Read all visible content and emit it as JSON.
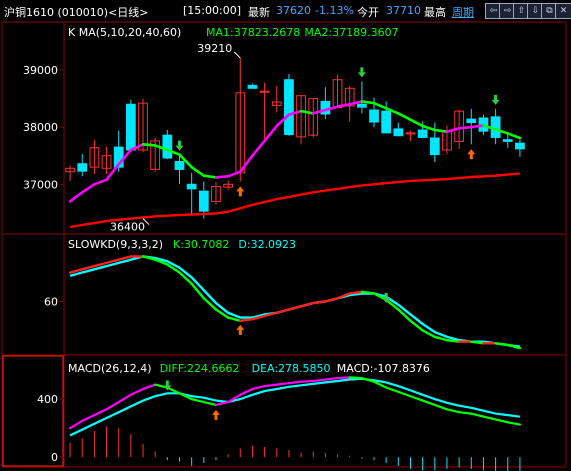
{
  "header": {
    "title": "沪铜1610 (010010)<日线>",
    "time": "[15:00:00]",
    "latest_label": "最新",
    "latest_value": "37620",
    "change_pct": "-1.13%",
    "open_label": "今开",
    "open_value": "37710",
    "high_label": "最高",
    "period_link": "周期",
    "buttons": [
      "⇦",
      "⇨",
      "⇧",
      "⇩",
      "⧉",
      "✕"
    ]
  },
  "colors": {
    "bg": "#000000",
    "grid": "#8b0000",
    "up": "#ff3030",
    "down": "#00e5ff",
    "ma1_up": "#ff00ff",
    "ma1_down": "#00ff00",
    "ma2": "#ff0000",
    "k_line": "#00ffff",
    "d_line": "#ff00ff",
    "axis_text": "#ffffff"
  },
  "chart_data": [
    {
      "type": "candlestick",
      "title": "K  MA(5,10,20,40,60)",
      "legend": [
        {
          "label": "MA1:37823.2678",
          "color": "#00ff00"
        },
        {
          "label": "MA2:37189.3607",
          "color": "#00ff00"
        }
      ],
      "yticks": [
        37000,
        38000,
        39000
      ],
      "ylim": [
        36200,
        39350
      ],
      "annotations": [
        {
          "text": "39210",
          "bar": 14,
          "value": 39210
        },
        {
          "text": "36400",
          "bar": 6,
          "value": 36400
        }
      ],
      "signals": [
        {
          "bar": 9,
          "kind": "sell"
        },
        {
          "bar": 14,
          "kind": "buy"
        },
        {
          "bar": 24,
          "kind": "sell"
        },
        {
          "bar": 33,
          "kind": "buy"
        },
        {
          "bar": 35,
          "kind": "sell"
        }
      ],
      "ohlc": [
        [
          37220,
          37330,
          37060,
          37280
        ],
        [
          37360,
          37530,
          37140,
          37230
        ],
        [
          37300,
          37780,
          37180,
          37640
        ],
        [
          37280,
          37660,
          37180,
          37500
        ],
        [
          37650,
          37940,
          37220,
          37300
        ],
        [
          38400,
          38480,
          37660,
          37600
        ],
        [
          37600,
          38500,
          37560,
          38420
        ],
        [
          37260,
          37820,
          37220,
          37760
        ],
        [
          37860,
          37950,
          37440,
          37460
        ],
        [
          37400,
          37520,
          37000,
          37260
        ],
        [
          37000,
          37200,
          36450,
          36920
        ],
        [
          36880,
          37050,
          36400,
          36530
        ],
        [
          36700,
          37040,
          36640,
          36960
        ],
        [
          36950,
          37070,
          36900,
          37000
        ],
        [
          37200,
          39210,
          37050,
          38600
        ],
        [
          38730,
          38760,
          38680,
          38680
        ],
        [
          38610,
          38780,
          37800,
          38630
        ],
        [
          38380,
          38720,
          38260,
          38440
        ],
        [
          38830,
          38930,
          37850,
          37870
        ],
        [
          37830,
          38550,
          37700,
          38550
        ],
        [
          37860,
          38500,
          37820,
          38500
        ],
        [
          38450,
          38700,
          38140,
          38230
        ],
        [
          38340,
          38920,
          38330,
          38830
        ],
        [
          38370,
          38720,
          38100,
          38680
        ],
        [
          38400,
          38800,
          38240,
          38350
        ],
        [
          38300,
          38520,
          38000,
          38090
        ],
        [
          38280,
          38450,
          37890,
          37900
        ],
        [
          37970,
          38080,
          37840,
          37850
        ],
        [
          37880,
          37940,
          37760,
          37900
        ],
        [
          37950,
          38100,
          37830,
          37820
        ],
        [
          37810,
          38080,
          37390,
          37520
        ],
        [
          37600,
          38030,
          37530,
          37940
        ],
        [
          37750,
          38300,
          37620,
          38280
        ],
        [
          38140,
          38320,
          37700,
          38080
        ],
        [
          38160,
          38220,
          37860,
          37930
        ],
        [
          38180,
          38320,
          37700,
          37820
        ],
        [
          37780,
          37920,
          37640,
          37750
        ],
        [
          37720,
          37780,
          37480,
          37620
        ]
      ],
      "series": [
        {
          "name": "MA1",
          "values": [
            36700,
            36860,
            37000,
            37080,
            37350,
            37600,
            37700,
            37680,
            37600,
            37520,
            37300,
            37150,
            37120,
            37140,
            37220,
            37500,
            37760,
            38020,
            38220,
            38280,
            38240,
            38300,
            38360,
            38400,
            38450,
            38420,
            38330,
            38240,
            38130,
            38020,
            37950,
            37920,
            37980,
            38000,
            38030,
            37960,
            37890,
            37810
          ]
        },
        {
          "name": "MA2",
          "values": [
            36250,
            36290,
            36320,
            36360,
            36380,
            36400,
            36420,
            36440,
            36450,
            36460,
            36470,
            36480,
            36490,
            36520,
            36580,
            36640,
            36690,
            36740,
            36780,
            36820,
            36860,
            36890,
            36920,
            36950,
            36980,
            37000,
            37020,
            37040,
            37060,
            37070,
            37080,
            37090,
            37110,
            37130,
            37140,
            37150,
            37170,
            37190
          ]
        }
      ]
    },
    {
      "type": "line",
      "title": "SLOWKD(9,3,3,2)",
      "legend": [
        {
          "label": "K:30.7082",
          "color": "#00ff00"
        },
        {
          "label": "D:32.0923",
          "color": "#00ffff"
        }
      ],
      "yticks": [
        60
      ],
      "ylim": [
        28,
        92
      ],
      "signals": [
        {
          "bar": 14,
          "kind": "buy"
        },
        {
          "bar": 26,
          "kind": "sell"
        }
      ],
      "series": [
        {
          "name": "K",
          "values": [
            78,
            80,
            82,
            84,
            86,
            88,
            88,
            86,
            83,
            78,
            71,
            62,
            55,
            50,
            48,
            49,
            51,
            53,
            55,
            57,
            59,
            60,
            62,
            65,
            66,
            65,
            61,
            55,
            48,
            42,
            38,
            36,
            35,
            35,
            34,
            34,
            33,
            31
          ]
        },
        {
          "name": "D",
          "values": [
            76,
            78,
            80,
            82,
            84,
            86,
            88,
            87,
            85,
            81,
            75,
            67,
            59,
            53,
            50,
            50,
            52,
            53,
            55,
            57,
            59,
            60,
            62,
            64,
            65,
            65,
            63,
            58,
            52,
            46,
            41,
            38,
            36,
            35,
            35,
            34,
            33,
            32
          ]
        }
      ]
    },
    {
      "type": "line",
      "title": "MACD(26,12,4)",
      "legend": [
        {
          "label": "DIFF:224.6662",
          "color": "#00ff00"
        },
        {
          "label": "DEA:278.5850",
          "color": "#00ffff"
        },
        {
          "label": "MACD:-107.8376",
          "color": "#ffffff"
        }
      ],
      "yticks": [
        0,
        400
      ],
      "ylim": [
        -40,
        580
      ],
      "signals": [
        {
          "bar": 8,
          "kind": "sell"
        },
        {
          "bar": 12,
          "kind": "buy"
        }
      ],
      "series": [
        {
          "name": "DIFF",
          "values": [
            200,
            250,
            290,
            330,
            380,
            430,
            470,
            500,
            480,
            440,
            400,
            380,
            360,
            380,
            430,
            470,
            490,
            500,
            510,
            520,
            525,
            535,
            545,
            550,
            545,
            520,
            480,
            450,
            420,
            390,
            360,
            330,
            310,
            300,
            280,
            260,
            240,
            225
          ]
        },
        {
          "name": "DEA",
          "values": [
            150,
            190,
            230,
            270,
            310,
            350,
            390,
            420,
            440,
            440,
            420,
            410,
            390,
            380,
            400,
            430,
            455,
            470,
            485,
            495,
            505,
            515,
            525,
            535,
            540,
            530,
            515,
            490,
            460,
            430,
            400,
            375,
            355,
            340,
            320,
            300,
            290,
            279
          ]
        },
        {
          "name": "MACD",
          "values": [
            100,
            130,
            180,
            210,
            200,
            160,
            90,
            40,
            -20,
            -30,
            -60,
            -40,
            -20,
            20,
            60,
            80,
            70,
            60,
            50,
            30,
            40,
            30,
            20,
            10,
            -10,
            -20,
            -40,
            -60,
            -80,
            -90,
            -90,
            -80,
            -70,
            -80,
            -90,
            -100,
            -100,
            -108
          ]
        }
      ]
    }
  ]
}
